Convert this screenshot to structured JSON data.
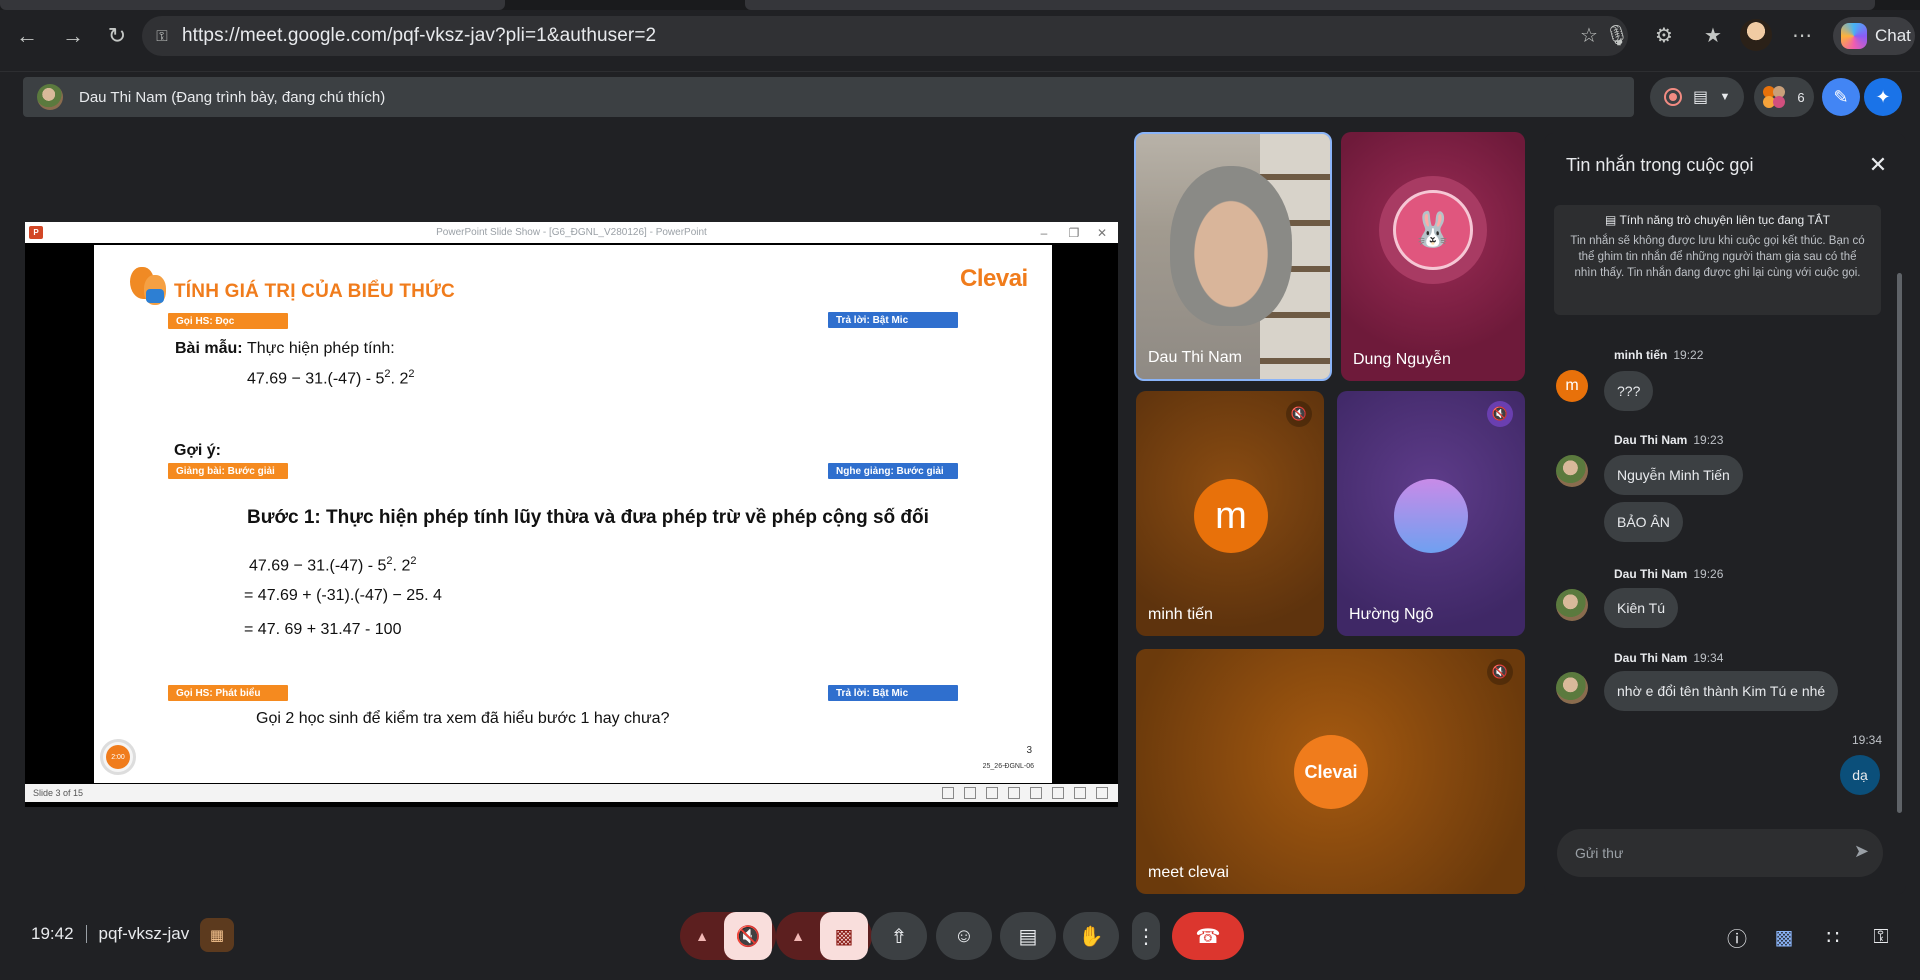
{
  "browser": {
    "url": "https://meet.google.com/pqf-vksz-jav?pli=1&authuser=2",
    "chat_button_label": "Chat"
  },
  "meet": {
    "presenter_label": "Dau Thi Nam (Đang trình bày, đang chú thích)",
    "participant_count": "6",
    "time": "19:42",
    "meeting_code": "pqf-vksz-jav"
  },
  "presentation": {
    "window_title": "PowerPoint Slide Show - [G6_ĐGNL_V280126] - PowerPoint",
    "status_text": "Slide 3 of 15",
    "slide": {
      "title": "TÍNH GIÁ TRỊ CỦA BIỂU THỨC",
      "brand": "Clevai",
      "tag_goi_doc": "Gọi HS: Đọc",
      "tag_tra_loi_1": "Trả lời: Bật Mic",
      "bai_mau_label": "Bài mẫu:",
      "bai_mau_text": "Thực hiện phép tính:",
      "expression_base": "47.69 − 31.(-47) - 5",
      "exp_a": "2",
      "expression_mid": ". 2",
      "exp_b": "2",
      "goi_y_label": "Gợi ý:",
      "tag_giang_bai": "Giảng bài: Bước giải",
      "tag_nghe_giang": "Nghe giảng: Bước giải",
      "step1": "Bước 1: Thực hiện phép tính lũy thừa và đưa phép trừ về phép cộng số đối",
      "line1_base": "47.69 − 31.(-47) - 5",
      "line2": "= 47.69 + (-31).(-47) − 25. 4",
      "line3": "= 47. 69 + 31.47 - 100",
      "tag_phat_bieu": "Gọi HS: Phát biểu",
      "tag_tra_loi_2": "Trả lời: Bật Mic",
      "question": "Gọi 2 học sinh để kiểm tra xem đã hiểu bước 1 hay chưa?",
      "timer": "2:00",
      "page_number": "3",
      "code": "25_26-ĐGNL-06"
    }
  },
  "participants": [
    {
      "name": "Dau Thi Nam"
    },
    {
      "name": "Dung Nguyễn"
    },
    {
      "name": "minh tiến",
      "initial": "m"
    },
    {
      "name": "Hường Ngô"
    },
    {
      "name": "meet clevai",
      "logo": "Clevai"
    }
  ],
  "chat": {
    "title": "Tin nhắn trong cuộc gọi",
    "notice_title": "Tính năng trò chuyện liên tục đang TẮT",
    "notice_body": "Tin nhắn sẽ không được lưu khi cuộc gọi kết thúc. Bạn có thể ghim tin nhắn để những người tham gia sau có thể nhìn thấy. Tin nhắn đang được ghi lại cùng với cuộc gọi.",
    "messages": [
      {
        "sender": "minh tiến",
        "time": "19:22",
        "lines": [
          "???"
        ]
      },
      {
        "sender": "Dau Thi Nam",
        "time": "19:23",
        "lines": [
          "Nguyễn Minh Tiến",
          "BẢO ÂN"
        ]
      },
      {
        "sender": "Dau Thi Nam",
        "time": "19:26",
        "lines": [
          "Kiên Tú"
        ]
      },
      {
        "sender": "Dau Thi Nam",
        "time": "19:34",
        "lines": [
          "nhờ e đổi tên thành Kim Tú e nhé"
        ]
      }
    ],
    "self_time": "19:34",
    "self_message": "dạ",
    "input_placeholder": "Gửi thư",
    "avatar_initial": "m"
  },
  "colors": {
    "accent_orange": "#f07c1c",
    "tag_blue": "#2f6fce",
    "leave_red": "#dc362e",
    "self_bubble": "#0b4f7a"
  },
  "icons": [
    "back-icon",
    "forward-icon",
    "reload-icon",
    "lock-icon",
    "star-icon",
    "mic-icon",
    "extensions-icon",
    "favorites-icon",
    "more-icon",
    "record-icon",
    "captions-off-icon",
    "chevron-down-icon",
    "people-icon",
    "pen-icon",
    "sparkle-icon",
    "close-icon",
    "chat-icon",
    "send-icon",
    "mic-off-icon",
    "camera-off-icon",
    "present-icon",
    "emoji-icon",
    "captions-icon",
    "hand-icon",
    "end-call-icon",
    "info-icon",
    "apps-icon",
    "host-controls-icon"
  ]
}
